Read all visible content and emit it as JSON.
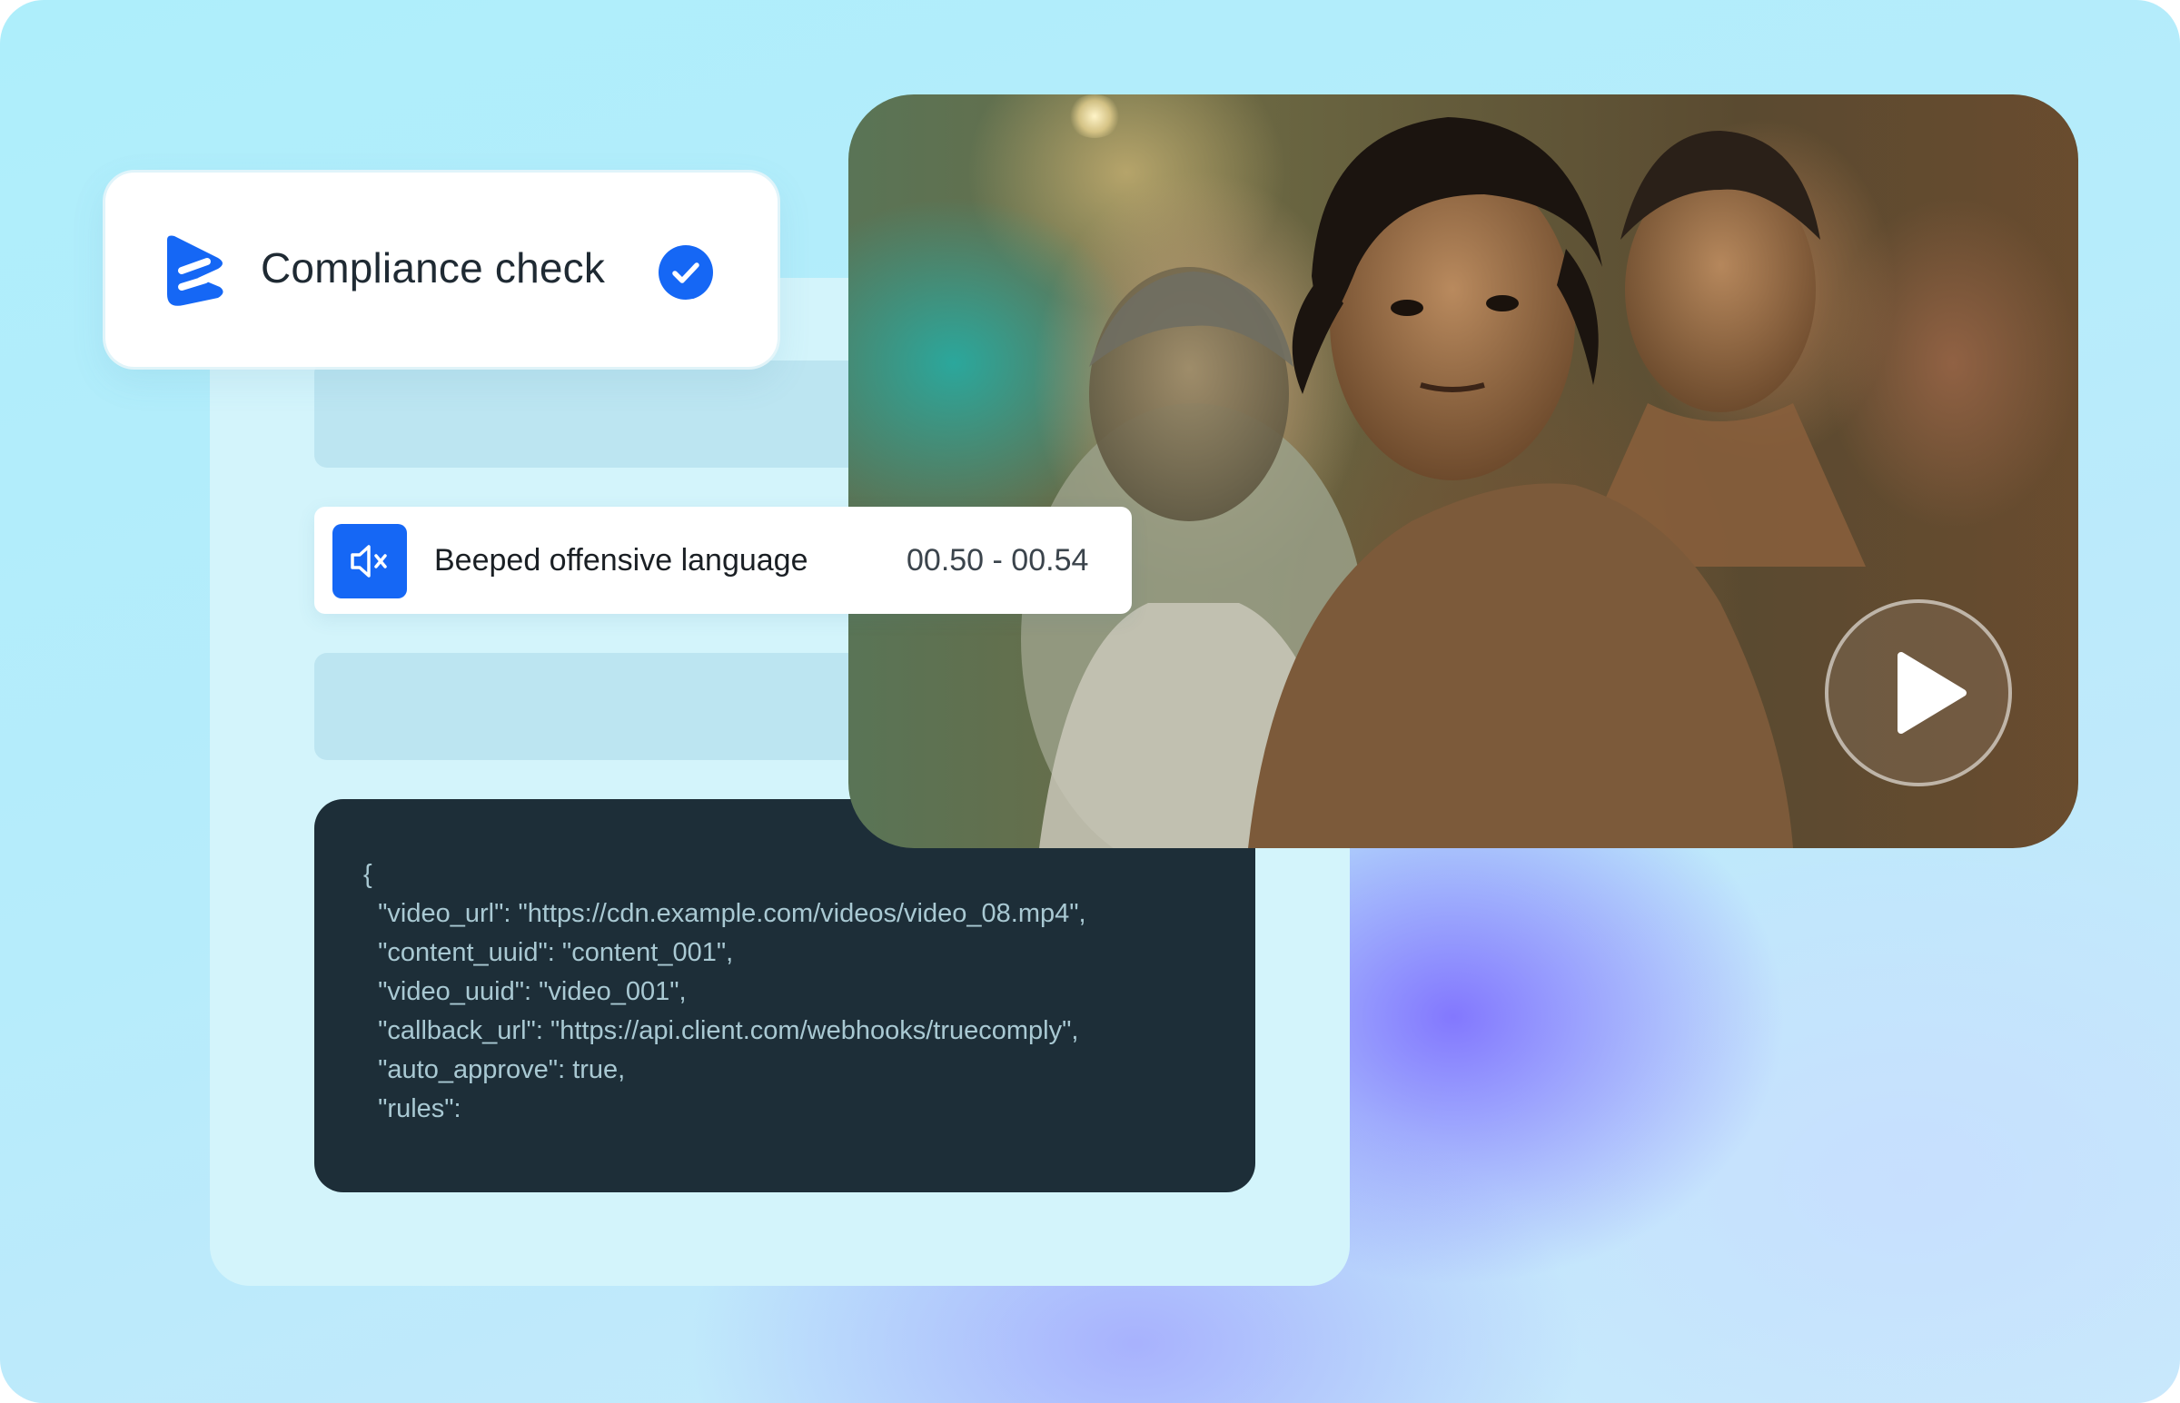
{
  "compliance_card": {
    "title": "Compliance check",
    "status_icon": "check-circle-icon",
    "brand_color": "#1567F5"
  },
  "beep_item": {
    "icon": "mute-icon",
    "label": "Beeped offensive language",
    "time_range": "00.50 - 00.54"
  },
  "code_block": {
    "lines": [
      "{",
      "  \"video_url\": \"https://cdn.example.com/videos/video_08.mp4\",",
      "  \"content_uuid\": \"content_001\",",
      "  \"video_uuid\": \"video_001\",",
      "  \"callback_url\": \"https://api.client.com/webhooks/truecomply\",",
      "  \"auto_approve\": true,",
      "  \"rules\":"
    ]
  },
  "video": {
    "play_icon": "play-icon"
  }
}
